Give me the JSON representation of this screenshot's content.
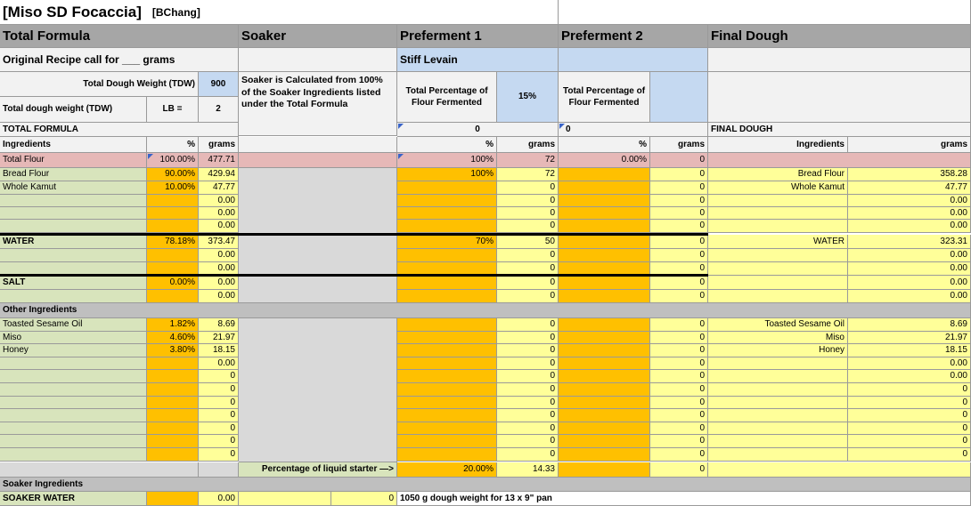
{
  "title": "[Miso SD Focaccia]",
  "author": "[BChang]",
  "sections": {
    "total_formula": "Total Formula",
    "soaker": "Soaker",
    "preferment1": "Preferment 1",
    "preferment2": "Preferment 2",
    "final_dough": "Final Dough"
  },
  "original_recipe": "Original Recipe call for ___ grams",
  "stiff_levain": "Stiff Levain",
  "tdw_label": "Total Dough Weight (TDW)",
  "tdw_value": "900",
  "tdw_lb_label": "Total dough weight (TDW)",
  "lb_label": "LB =",
  "lb_value": "2",
  "soaker_note": "Soaker is Calculated from 100% of the Soaker Ingredients listed under the Total Formula",
  "pf1_pct_label": "Total Percentage of Flour Fermented",
  "pf1_pct_value": "15%",
  "pf2_pct_label": "Total Percentage of Flour Fermented",
  "total_formula_label": "TOTAL FORMULA",
  "pf1_zero": "0",
  "pf2_zero": "0",
  "final_dough_label": "FINAL DOUGH",
  "col": {
    "ingredients": "Ingredients",
    "pct": "%",
    "grams": "grams"
  },
  "total_flour": {
    "label": "Total Flour",
    "pct": "100.00%",
    "grams": "477.71",
    "pf1_pct": "100%",
    "pf1_g": "72",
    "pf2_pct": "0.00%",
    "pf2_g": "0"
  },
  "rows": [
    {
      "name": "Bread Flour",
      "pct": "90.00%",
      "grams": "429.94",
      "pf1_pct": "100%",
      "pf1_g": "72",
      "pf2_g": "0",
      "fd_name": "Bread Flour",
      "fd_g": "358.28"
    },
    {
      "name": "Whole Kamut",
      "pct": "10.00%",
      "grams": "47.77",
      "pf1_pct": "",
      "pf1_g": "0",
      "pf2_g": "0",
      "fd_name": "Whole Kamut",
      "fd_g": "47.77"
    },
    {
      "name": "",
      "pct": "",
      "grams": "0.00",
      "pf1_pct": "",
      "pf1_g": "0",
      "pf2_g": "0",
      "fd_name": "",
      "fd_g": "0.00"
    },
    {
      "name": "",
      "pct": "",
      "grams": "0.00",
      "pf1_pct": "",
      "pf1_g": "0",
      "pf2_g": "0",
      "fd_name": "",
      "fd_g": "0.00"
    },
    {
      "name": "",
      "pct": "",
      "grams": "0.00",
      "pf1_pct": "",
      "pf1_g": "0",
      "pf2_g": "0",
      "fd_name": "",
      "fd_g": "0.00"
    },
    {
      "name": "WATER",
      "pct": "78.18%",
      "grams": "373.47",
      "pf1_pct": "70%",
      "pf1_g": "50",
      "pf2_g": "0",
      "fd_name": "WATER",
      "fd_g": "323.31"
    },
    {
      "name": "",
      "pct": "",
      "grams": "0.00",
      "pf1_pct": "",
      "pf1_g": "0",
      "pf2_g": "0",
      "fd_name": "",
      "fd_g": "0.00"
    },
    {
      "name": "",
      "pct": "",
      "grams": "0.00",
      "pf1_pct": "",
      "pf1_g": "0",
      "pf2_g": "0",
      "fd_name": "",
      "fd_g": "0.00"
    },
    {
      "name": "SALT",
      "pct": "0.00%",
      "grams": "0.00",
      "pf1_pct": "",
      "pf1_g": "0",
      "pf2_g": "0",
      "fd_name": "",
      "fd_g": "0.00"
    },
    {
      "name": "",
      "pct": "",
      "grams": "0.00",
      "pf1_pct": "",
      "pf1_g": "0",
      "pf2_g": "0",
      "fd_name": "",
      "fd_g": "0.00"
    }
  ],
  "other_ingredients_label": "Other Ingredients",
  "other_rows": [
    {
      "name": "Toasted Sesame Oil",
      "pct": "1.82%",
      "grams": "8.69",
      "pf1_g": "0",
      "pf2_g": "0",
      "fd_name": "Toasted Sesame Oil",
      "fd_g": "8.69"
    },
    {
      "name": "Miso",
      "pct": "4.60%",
      "grams": "21.97",
      "pf1_g": "0",
      "pf2_g": "0",
      "fd_name": "Miso",
      "fd_g": "21.97"
    },
    {
      "name": "Honey",
      "pct": "3.80%",
      "grams": "18.15",
      "pf1_g": "0",
      "pf2_g": "0",
      "fd_name": "Honey",
      "fd_g": "18.15"
    },
    {
      "name": "",
      "pct": "",
      "grams": "0.00",
      "pf1_g": "0",
      "pf2_g": "0",
      "fd_name": "",
      "fd_g": "0.00"
    },
    {
      "name": "",
      "pct": "",
      "grams": "0",
      "pf1_g": "0",
      "pf2_g": "0",
      "fd_name": "",
      "fd_g": "0.00"
    },
    {
      "name": "",
      "pct": "",
      "grams": "0",
      "pf1_g": "0",
      "pf2_g": "0",
      "fd_name": "",
      "fd_g": "0"
    },
    {
      "name": "",
      "pct": "",
      "grams": "0",
      "pf1_g": "0",
      "pf2_g": "0",
      "fd_name": "",
      "fd_g": "0"
    },
    {
      "name": "",
      "pct": "",
      "grams": "0",
      "pf1_g": "0",
      "pf2_g": "0",
      "fd_name": "",
      "fd_g": "0"
    },
    {
      "name": "",
      "pct": "",
      "grams": "0",
      "pf1_g": "0",
      "pf2_g": "0",
      "fd_name": "",
      "fd_g": "0"
    },
    {
      "name": "",
      "pct": "",
      "grams": "0",
      "pf1_g": "0",
      "pf2_g": "0",
      "fd_name": "",
      "fd_g": "0"
    },
    {
      "name": "",
      "pct": "",
      "grams": "0",
      "pf1_g": "0",
      "pf2_g": "0",
      "fd_name": "",
      "fd_g": "0"
    }
  ],
  "liquid_starter_label": "Percentage of liquid starter —>",
  "liquid_starter_pct": "20.00%",
  "liquid_starter_g": "14.33",
  "liquid_pf2_g": "0",
  "soaker_ingredients_label": "Soaker Ingredients",
  "soaker_water": {
    "label": "SOAKER WATER",
    "grams": "0.00",
    "soaker_g": "0"
  },
  "pan_note": "1050 g dough weight for 13 x 9\" pan",
  "colors": {
    "green": "#d8e4bc",
    "orange": "#ffc000",
    "yellow": "#ffff99",
    "blue": "#c5d9f1",
    "pink": "#e6b8b7",
    "gray": "#bfbfbf",
    "lightgray": "#d9d9d9",
    "header": "#a6a6a6",
    "cream": "#f2f2f2"
  }
}
